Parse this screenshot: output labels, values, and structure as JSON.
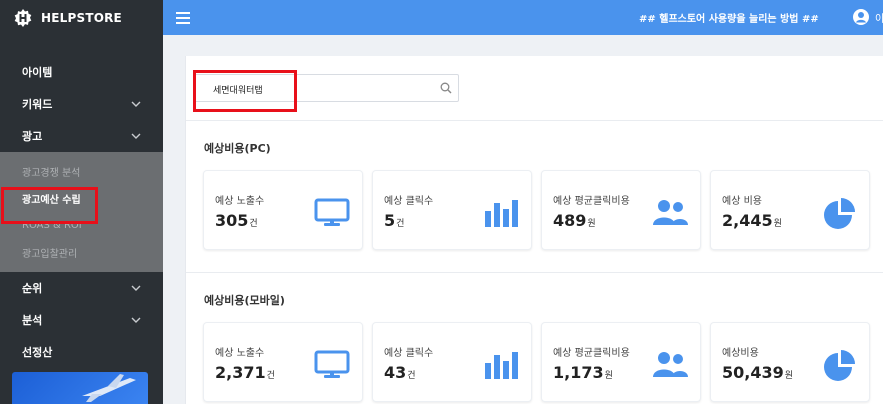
{
  "brand": {
    "name": "HELPSTORE"
  },
  "topbar": {
    "tip": "## 헬프스토어 사용량을 늘리는 방법 ##",
    "user_initial": "이"
  },
  "sidebar": {
    "items": [
      {
        "label": "아이템",
        "chevron": false
      },
      {
        "label": "키워드",
        "chevron": true
      },
      {
        "label": "광고",
        "chevron": true
      }
    ],
    "submenu": [
      {
        "label": "광고경쟁 분석",
        "active": false
      },
      {
        "label": "광고예산 수립",
        "active": true
      },
      {
        "label": "ROAS & ROI",
        "active": false
      },
      {
        "label": "광고입찰관리",
        "active": false
      }
    ],
    "items_after": [
      {
        "label": "순위",
        "chevron": true
      },
      {
        "label": "분석",
        "chevron": true
      },
      {
        "label": "선정산",
        "chevron": false
      }
    ]
  },
  "search": {
    "value": "세면대워터탭"
  },
  "sections": [
    {
      "title": "예상비용(PC)",
      "cards": [
        {
          "label": "예상 노출수",
          "value": "305",
          "unit": "건",
          "icon": "monitor-icon"
        },
        {
          "label": "예상 클릭수",
          "value": "5",
          "unit": "건",
          "icon": "bar-chart-icon"
        },
        {
          "label": "예상 평균클릭비용",
          "value": "489",
          "unit": "원",
          "icon": "users-icon"
        },
        {
          "label": "예상 비용",
          "value": "2,445",
          "unit": "원",
          "icon": "pie-chart-icon"
        }
      ]
    },
    {
      "title": "예상비용(모바일)",
      "cards": [
        {
          "label": "예상 노출수",
          "value": "2,371",
          "unit": "건",
          "icon": "monitor-icon"
        },
        {
          "label": "예상 클릭수",
          "value": "43",
          "unit": "건",
          "icon": "bar-chart-icon"
        },
        {
          "label": "예상 평균클릭비용",
          "value": "1,173",
          "unit": "원",
          "icon": "users-icon"
        },
        {
          "label": "예상비용",
          "value": "50,439",
          "unit": "원",
          "icon": "pie-chart-icon"
        }
      ]
    }
  ],
  "colors": {
    "accent": "#4a93ed",
    "sidebar": "#2b3035",
    "annotation": "#e8101a"
  }
}
